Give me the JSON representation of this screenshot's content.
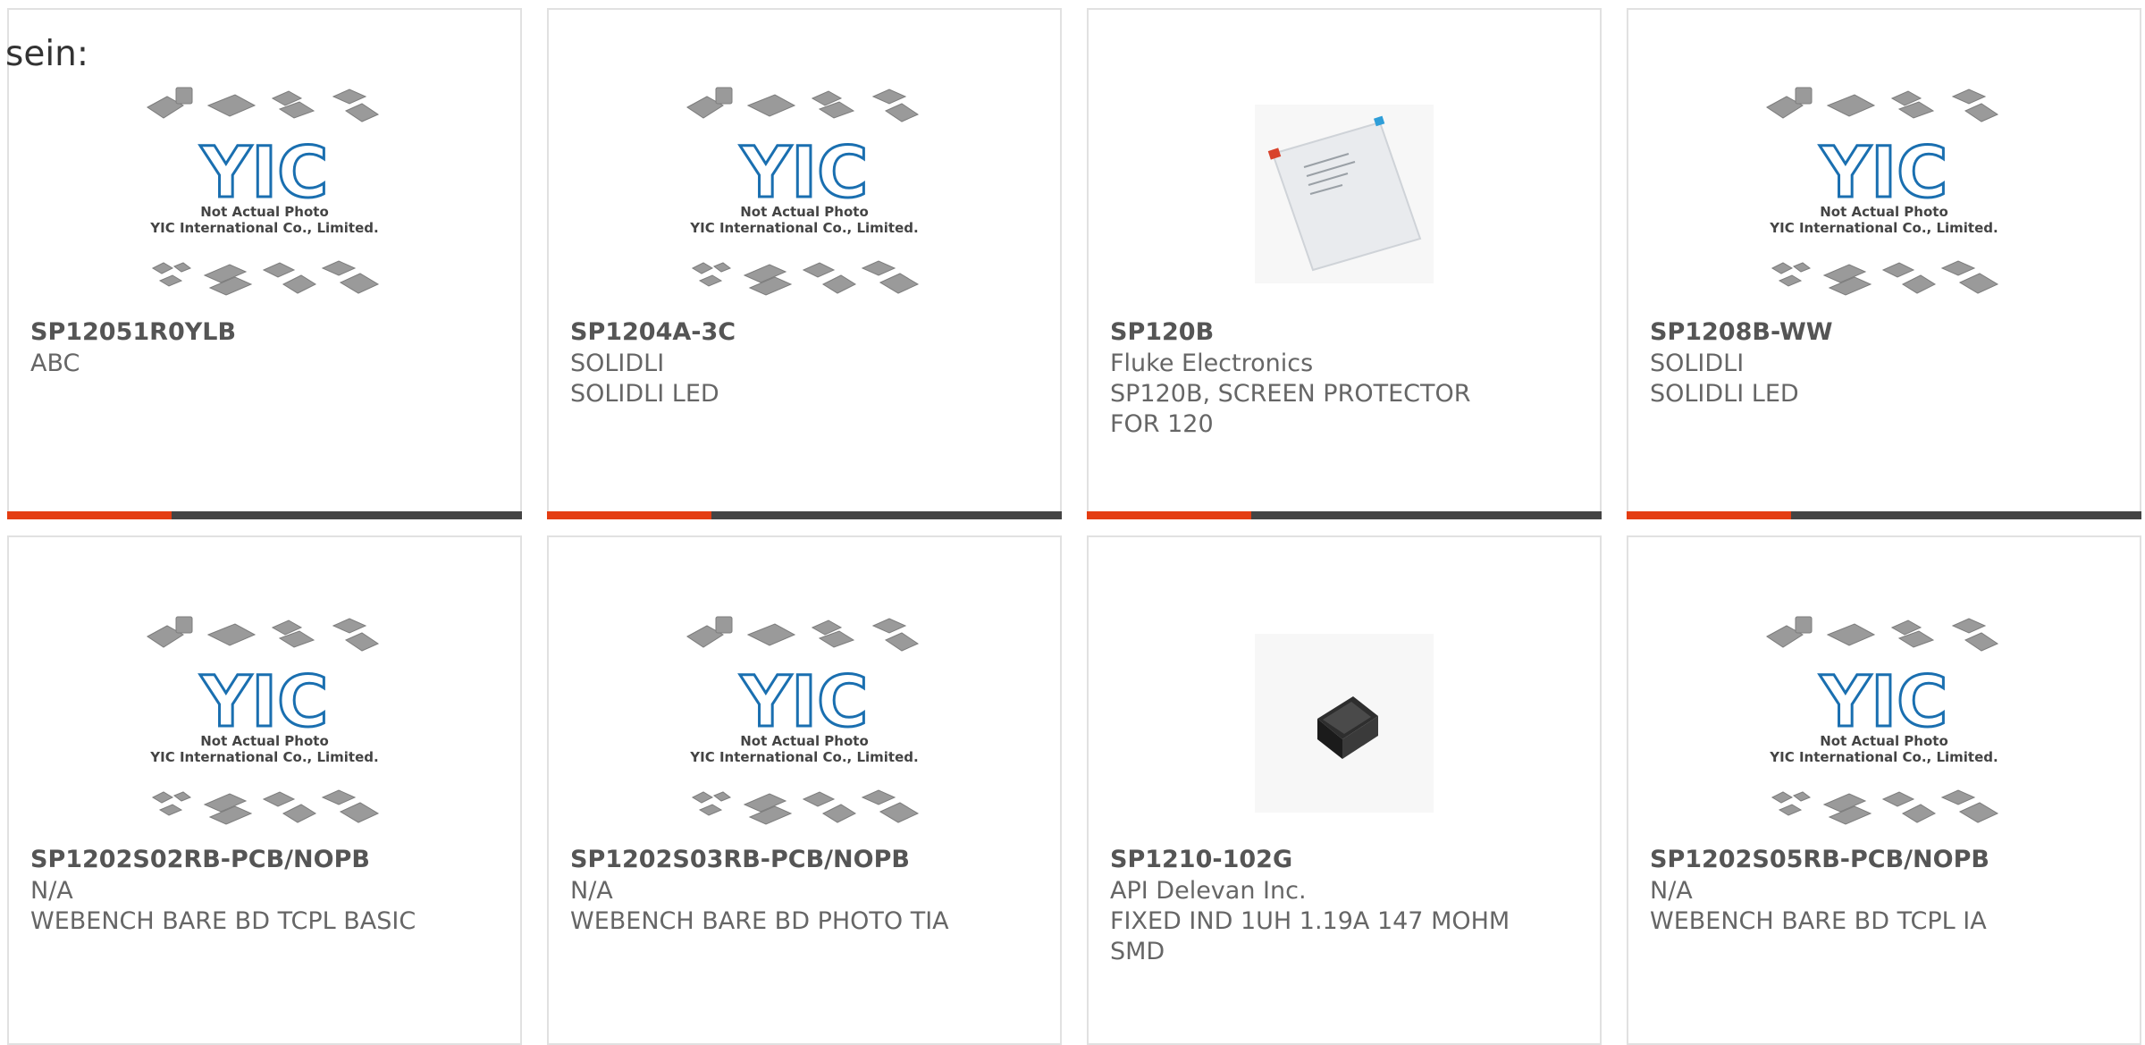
{
  "overlay_text": "sein:",
  "placeholder_image": {
    "caption_line1": "Not Actual Photo",
    "caption_line2": "YIC International Co., Limited.",
    "logo_text": "YIC"
  },
  "products": [
    {
      "part": "SP12051R0YLB",
      "lines": [
        "ABC"
      ],
      "image": "placeholder"
    },
    {
      "part": "SP1204A-3C",
      "lines": [
        "SOLIDLI",
        "SOLIDLI LED"
      ],
      "image": "placeholder"
    },
    {
      "part": "SP120B",
      "lines": [
        "Fluke Electronics",
        "SP120B, SCREEN PROTECTOR",
        "FOR 120"
      ],
      "image": "screen-protector"
    },
    {
      "part": "SP1208B-WW",
      "lines": [
        "SOLIDLI",
        "SOLIDLI LED"
      ],
      "image": "placeholder"
    },
    {
      "part": "SP1202S02RB-PCB/NOPB",
      "lines": [
        "N/A",
        "WEBENCH BARE BD TCPL BASIC"
      ],
      "image": "placeholder"
    },
    {
      "part": "SP1202S03RB-PCB/NOPB",
      "lines": [
        "N/A",
        "WEBENCH BARE BD PHOTO TIA"
      ],
      "image": "placeholder"
    },
    {
      "part": "SP1210-102G",
      "lines": [
        "API Delevan Inc.",
        "FIXED IND 1UH 1.19A 147 MOHM",
        "SMD"
      ],
      "image": "inductor"
    },
    {
      "part": "SP1202S05RB-PCB/NOPB",
      "lines": [
        "N/A",
        "WEBENCH BARE BD TCPL IA"
      ],
      "image": "placeholder"
    }
  ],
  "colors": {
    "accent": "#e43d12",
    "bar": "#444444",
    "logo": "#1a6fb0"
  }
}
